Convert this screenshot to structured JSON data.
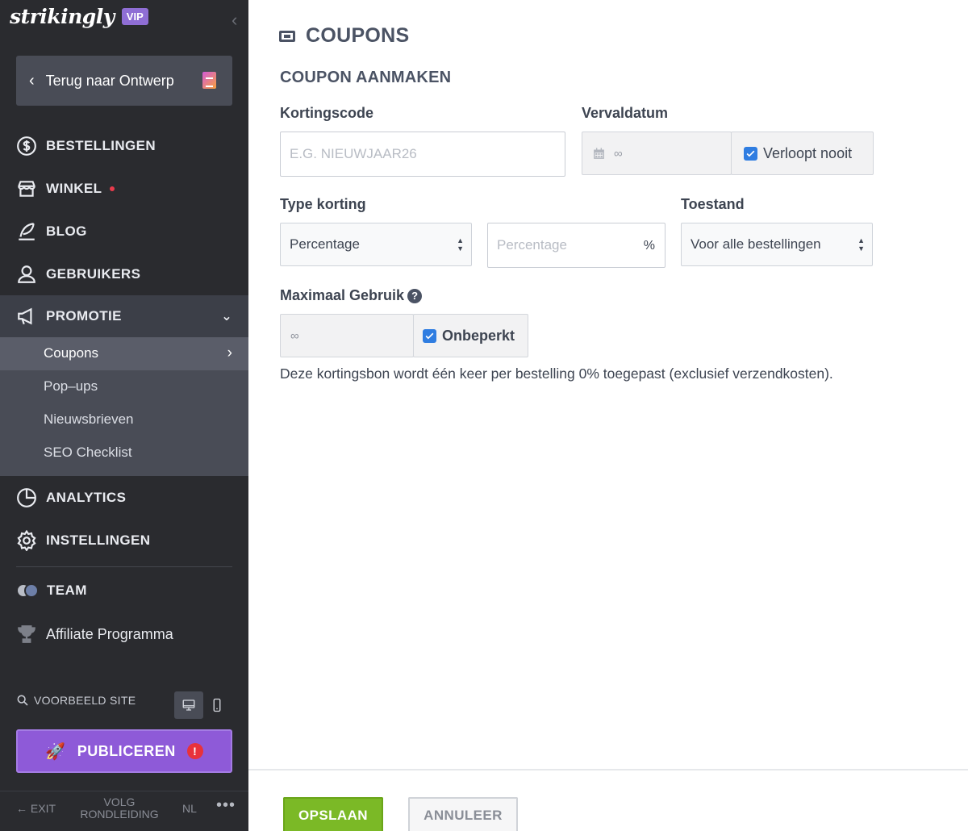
{
  "sidebar": {
    "brand": "strikingly",
    "vip_badge": "VIP",
    "back_button": "Terug naar Ontwerp",
    "nav": {
      "orders": "BESTELLINGEN",
      "store": "WINKEL",
      "blog": "BLOG",
      "users": "GEBRUIKERS",
      "promotion": "PROMOTIE",
      "analytics": "ANALYTICS",
      "settings": "INSTELLINGEN",
      "team": "TEAM",
      "affiliate": "Affiliate Programma"
    },
    "subnav": {
      "coupons": "Coupons",
      "popups": "Pop–ups",
      "newsletters": "Nieuwsbrieven",
      "seo": "SEO Checklist"
    },
    "preview_label": "VOORBEELD SITE",
    "publish_label": "PUBLICEREN",
    "publish_alert": "!",
    "bottom": {
      "exit": "EXIT",
      "tour_line1": "VOLG",
      "tour_line2": "RONDLEIDING",
      "language": "NL",
      "more": "•••"
    }
  },
  "main": {
    "page_title": "COUPONS",
    "section_title": "COUPON AANMAKEN",
    "discount_code": {
      "label": "Kortingscode",
      "placeholder": "E.G. NIEUWJAAR26",
      "value": ""
    },
    "expiry": {
      "label": "Vervaldatum",
      "value": "∞",
      "never_expires_label": "Verloopt nooit",
      "never_expires_checked": true
    },
    "discount_type": {
      "label": "Type korting",
      "selected": "Percentage",
      "amount_placeholder": "Percentage",
      "unit": "%"
    },
    "condition": {
      "label": "Toestand",
      "selected": "Voor alle bestellingen"
    },
    "max_usage": {
      "label": "Maximaal Gebruik",
      "help": "?",
      "value": "∞",
      "unlimited_label": "Onbeperkt",
      "unlimited_checked": true
    },
    "note": "Deze kortingsbon wordt één keer per bestelling 0% toegepast (exclusief verzendkosten).",
    "save_button": "OPSLAAN",
    "cancel_button": "ANNULEER"
  },
  "colors": {
    "sidebar_bg": "#2a2b2f",
    "accent_purple": "#8e5ad8",
    "save_green": "#7bb926",
    "checkbox_blue": "#2f7de1",
    "alert_red": "#e8323b"
  }
}
